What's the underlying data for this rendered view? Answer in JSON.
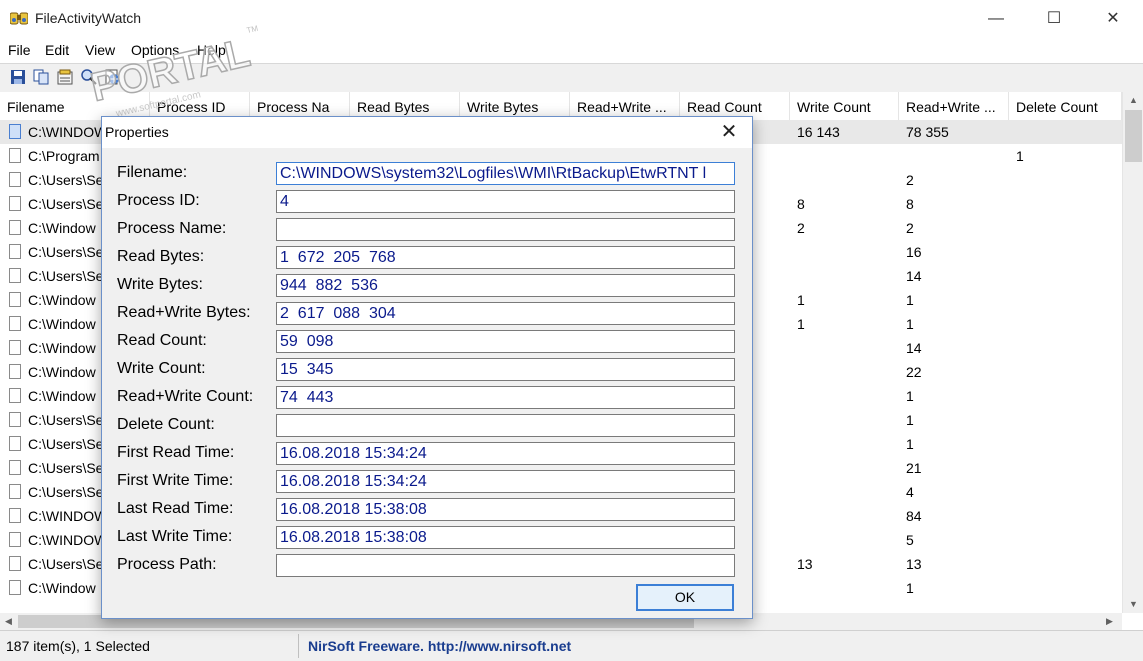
{
  "window": {
    "title": "FileActivityWatch",
    "minimize_glyph": "—",
    "maximize_glyph": "☐",
    "close_glyph": "✕"
  },
  "menu": [
    "File",
    "Edit",
    "View",
    "Options",
    "Help"
  ],
  "toolbar": {
    "icons": [
      "save-icon",
      "copy-icon",
      "properties-icon",
      "find-icon",
      "html-report-icon"
    ]
  },
  "columns": [
    "Filename",
    "Process ID",
    "Process Na",
    "Read Bytes",
    "Write Bytes",
    "Read+Write ...",
    "Read Count",
    "Write Count",
    "Read+Write ...",
    "Delete Count"
  ],
  "rows": [
    {
      "filename": "C:\\WINDOW",
      "write_count": "16 143",
      "rw_count": "78 355",
      "delete_count": "",
      "selected": true
    },
    {
      "filename": "C:\\Program",
      "write_count": "",
      "rw_count": "",
      "delete_count": "1"
    },
    {
      "filename": "C:\\Users\\Se",
      "write_count": "",
      "rw_count": "2",
      "delete_count": ""
    },
    {
      "filename": "C:\\Users\\Se",
      "write_count": "8",
      "rw_count": "8",
      "delete_count": ""
    },
    {
      "filename": "C:\\Window",
      "write_count": "2",
      "rw_count": "2",
      "delete_count": ""
    },
    {
      "filename": "C:\\Users\\Se",
      "write_count": "",
      "rw_count": "16",
      "delete_count": ""
    },
    {
      "filename": "C:\\Users\\Se",
      "write_count": "",
      "rw_count": "14",
      "delete_count": ""
    },
    {
      "filename": "C:\\Window",
      "write_count": "1",
      "rw_count": "1",
      "delete_count": ""
    },
    {
      "filename": "C:\\Window",
      "write_count": "1",
      "rw_count": "1",
      "delete_count": ""
    },
    {
      "filename": "C:\\Window",
      "write_count": "",
      "rw_count": "14",
      "delete_count": ""
    },
    {
      "filename": "C:\\Window",
      "write_count": "",
      "rw_count": "22",
      "delete_count": ""
    },
    {
      "filename": "C:\\Window",
      "write_count": "",
      "rw_count": "1",
      "delete_count": ""
    },
    {
      "filename": "C:\\Users\\Se",
      "write_count": "",
      "rw_count": "1",
      "delete_count": ""
    },
    {
      "filename": "C:\\Users\\Se",
      "write_count": "",
      "rw_count": "1",
      "delete_count": ""
    },
    {
      "filename": "C:\\Users\\Se",
      "write_count": "",
      "rw_count": "21",
      "delete_count": ""
    },
    {
      "filename": "C:\\Users\\Se",
      "write_count": "",
      "rw_count": "4",
      "delete_count": ""
    },
    {
      "filename": "C:\\WINDOW",
      "write_count": "",
      "rw_count": "84",
      "delete_count": ""
    },
    {
      "filename": "C:\\WINDOW",
      "write_count": "",
      "rw_count": "5",
      "delete_count": ""
    },
    {
      "filename": "C:\\Users\\Se",
      "write_count": "13",
      "rw_count": "13",
      "delete_count": ""
    },
    {
      "filename": "C:\\Window",
      "write_count": "",
      "rw_count": "1",
      "delete_count": ""
    }
  ],
  "status": {
    "items": "187 item(s), 1 Selected",
    "credit": "NirSoft Freeware.  http://www.nirsoft.net",
    "credit_color": "#1a3d8f"
  },
  "watermark": {
    "text": "PORTAL",
    "url": "www.softportal.com",
    "tm": "TM"
  },
  "dialog": {
    "title": "Properties",
    "close_glyph": "✕",
    "ok_label": "OK",
    "value_color": "#0a1a8c",
    "fields": [
      {
        "label": "Filename:",
        "value": "C:\\WINDOWS\\system32\\Logfiles\\WMI\\RtBackup\\EtwRTNT l"
      },
      {
        "label": "Process ID:",
        "value": "4"
      },
      {
        "label": "Process Name:",
        "value": ""
      },
      {
        "label": "Read Bytes:",
        "value": "1  672  205  768"
      },
      {
        "label": "Write Bytes:",
        "value": "944  882  536"
      },
      {
        "label": "Read+Write Bytes:",
        "value": "2  617  088  304"
      },
      {
        "label": "Read Count:",
        "value": "59  098"
      },
      {
        "label": "Write Count:",
        "value": "15  345"
      },
      {
        "label": "Read+Write Count:",
        "value": "74  443"
      },
      {
        "label": "Delete Count:",
        "value": ""
      },
      {
        "label": "First Read Time:",
        "value": "16.08.2018 15:34:24"
      },
      {
        "label": "First Write Time:",
        "value": "16.08.2018 15:34:24"
      },
      {
        "label": "Last Read Time:",
        "value": "16.08.2018 15:38:08"
      },
      {
        "label": "Last Write Time:",
        "value": "16.08.2018 15:38:08"
      },
      {
        "label": "Process Path:",
        "value": ""
      }
    ]
  }
}
